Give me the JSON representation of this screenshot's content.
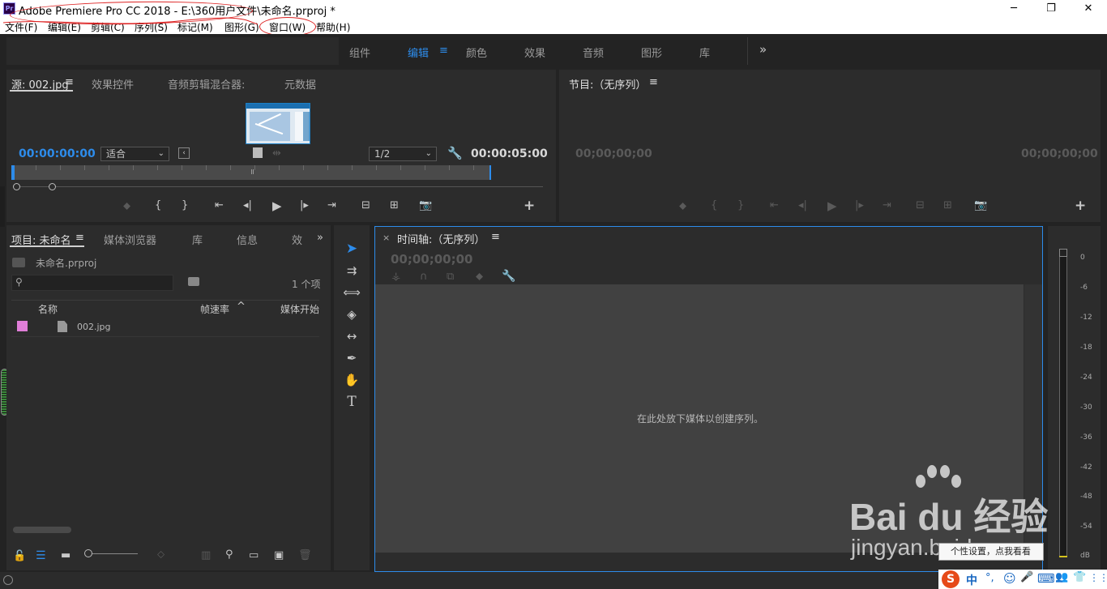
{
  "window": {
    "app_icon": "Pr",
    "title": "Adobe Premiere Pro CC 2018 - E:\\360用户文件\\未命名.prproj *",
    "minimize": "─",
    "maximize": "❐",
    "close": "✕"
  },
  "menu": {
    "file": "文件(F)",
    "edit": "编辑(E)",
    "clip": "剪辑(C)",
    "sequence": "序列(S)",
    "markers": "标记(M)",
    "graphics": "图形(G)",
    "window": "窗口(W)",
    "help": "帮助(H)"
  },
  "workspaces": {
    "items": [
      "组件",
      "编辑",
      "颜色",
      "效果",
      "音频",
      "图形",
      "库"
    ],
    "active": "编辑",
    "menu_icon": "≡",
    "overflow": "»"
  },
  "source_panel": {
    "tabs": [
      "源: 002.jpg",
      "效果控件",
      "音频剪辑混合器:",
      "元数据"
    ],
    "tab_menu": "≡",
    "timecode_in": "00:00:00:00",
    "fit": "适合",
    "resolution": "1/2",
    "timecode_duration": "00:00:05:00",
    "add": "+"
  },
  "program_panel": {
    "title": "节目:（无序列）",
    "tab_menu": "≡",
    "timecode_left": "00;00;00;00",
    "timecode_right": "00;00;00;00",
    "add": "+"
  },
  "project_panel": {
    "tabs": [
      "项目: 未命名",
      "媒体浏览器",
      "库",
      "信息",
      "效"
    ],
    "tab_menu": "≡",
    "overflow": "»",
    "project_file": "未命名.prproj",
    "search_placeholder": "",
    "item_count": "1 个项",
    "columns": [
      "名称",
      "帧速率",
      "媒体开始"
    ],
    "rows": [
      {
        "name": "002.jpg",
        "label_color": "#e07ed8"
      }
    ]
  },
  "timeline_panel": {
    "close": "×",
    "title": "时间轴:（无序列）",
    "tab_menu": "≡",
    "timecode": "00;00;00;00",
    "drop_hint": "在此处放下媒体以创建序列。"
  },
  "audio_meter": {
    "scale": [
      "0",
      "-6",
      "-12",
      "-18",
      "-24",
      "-30",
      "-36",
      "-42",
      "-48",
      "-54",
      "dB"
    ]
  },
  "tooltip": {
    "text": "个性设置，点我看看"
  },
  "watermark": {
    "brand": "Bai du 经验",
    "url": "jingyan.baidu.com"
  },
  "taskbar_ime": {
    "items": [
      "S",
      "中",
      "°,",
      "☺",
      "🎤",
      "⌨",
      "👥",
      "👕",
      "⋮⋮"
    ]
  },
  "colors": {
    "accent": "#2d8ceb",
    "panel_bg": "#2c2c2c",
    "app_bg": "#232323",
    "annotation_red": "#dd2222"
  }
}
